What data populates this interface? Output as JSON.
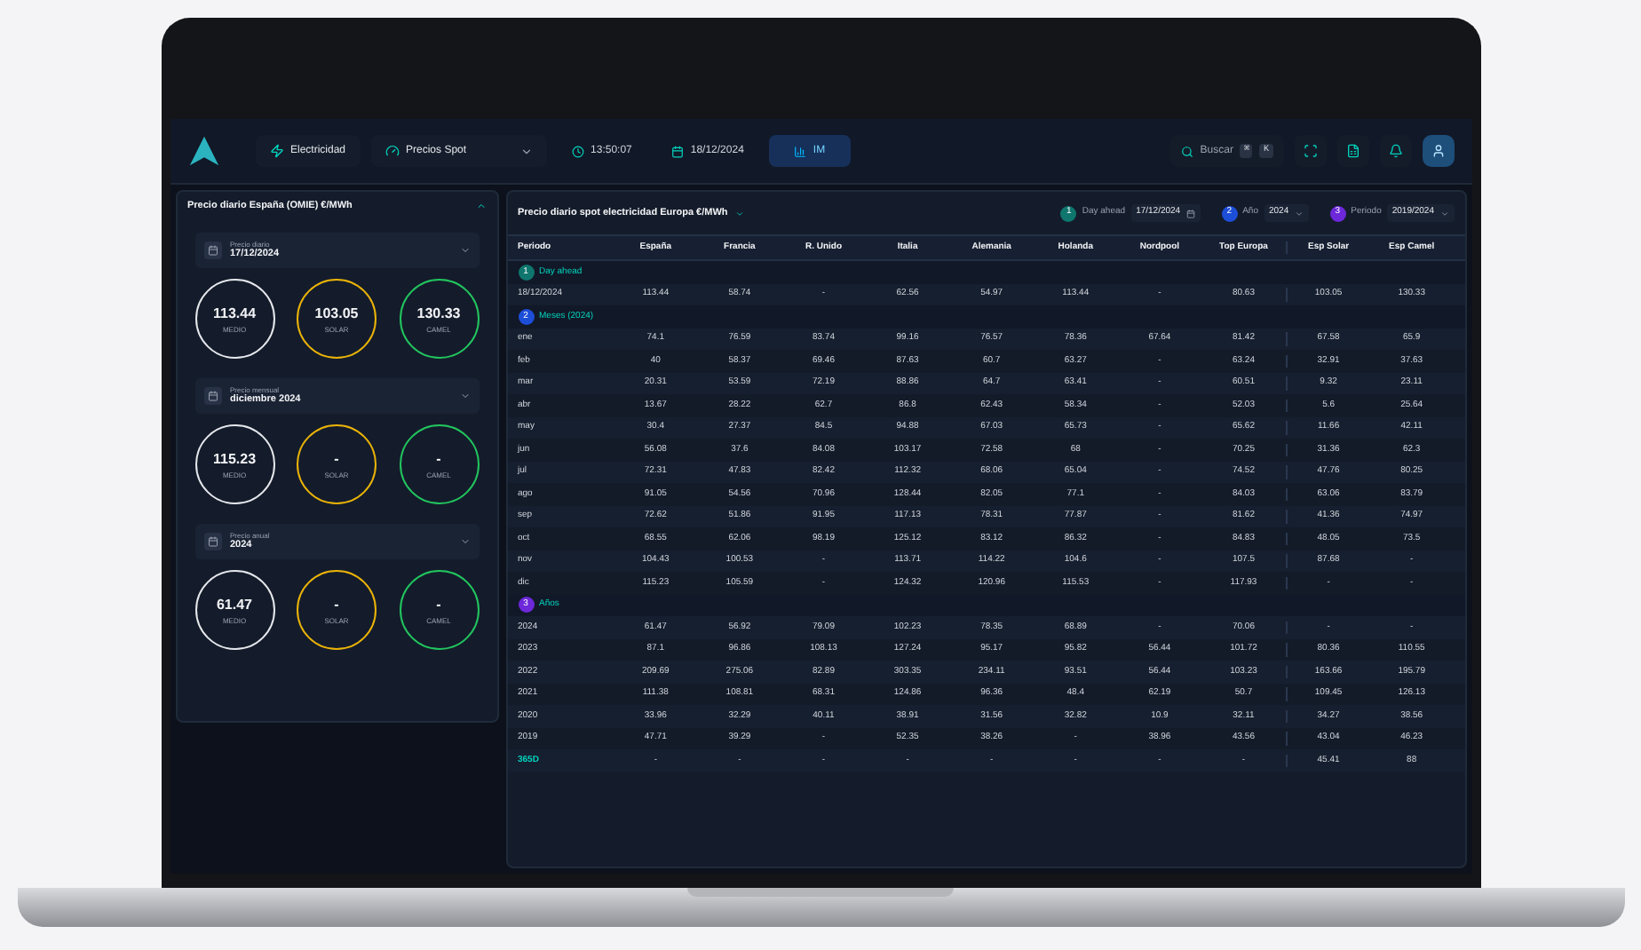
{
  "topbar": {
    "nav": [
      {
        "kind": "module",
        "label": "Electricidad"
      },
      {
        "kind": "dropdown",
        "label": "Precios Spot"
      },
      {
        "kind": "time",
        "label": "13:50:07"
      },
      {
        "kind": "date",
        "label": "18/12/2024"
      },
      {
        "kind": "button",
        "label": "IM"
      }
    ],
    "search": {
      "placeholder": "Buscar",
      "keys": [
        "⌘",
        "K"
      ]
    }
  },
  "left_panel": {
    "title": "Precio diario España (OMIE) €/MWh",
    "expanded": true,
    "sections": [
      {
        "label": "Precio diario",
        "value": "17/12/2024",
        "circles": [
          {
            "value": "113.44",
            "label": "MEDIO",
            "color": "#e5e7eb"
          },
          {
            "value": "103.05",
            "label": "SOLAR",
            "color": "#eab308"
          },
          {
            "value": "130.33",
            "label": "CAMEL",
            "color": "#22c55e"
          }
        ]
      },
      {
        "label": "Precio mensual",
        "value": "diciembre 2024",
        "circles": [
          {
            "value": "115.23",
            "label": "MEDIO",
            "color": "#e5e7eb"
          },
          {
            "value": "-",
            "label": "SOLAR",
            "color": "#eab308"
          },
          {
            "value": "-",
            "label": "CAMEL",
            "color": "#22c55e"
          }
        ]
      },
      {
        "label": "Precio anual",
        "value": "2024",
        "circles": [
          {
            "value": "61.47",
            "label": "MEDIO",
            "color": "#e5e7eb"
          },
          {
            "value": "-",
            "label": "SOLAR",
            "color": "#eab308"
          },
          {
            "value": "-",
            "label": "CAMEL",
            "color": "#22c55e"
          }
        ]
      }
    ]
  },
  "table_panel": {
    "title": "Precio diario spot electricidad Europa €/MWh",
    "filters": [
      {
        "badge": "1",
        "color": "#0f766e",
        "label": "Day ahead",
        "value": "17/12/2024",
        "kind": "date"
      },
      {
        "badge": "2",
        "color": "#1d4ed8",
        "label": "Año",
        "value": "2024",
        "kind": "select"
      },
      {
        "badge": "3",
        "color": "#6d28d9",
        "label": "Periodo",
        "value": "2019/2024",
        "kind": "select"
      }
    ],
    "columns": [
      "Periodo",
      "España",
      "Francia",
      "R. Unido",
      "Italia",
      "Alemania",
      "Holanda",
      "Nordpool",
      "Top Europa",
      "Esp Solar",
      "Esp Camel"
    ],
    "groups": [
      {
        "badge": "1",
        "color": "#0f766e",
        "label": "Day ahead",
        "rows": [
          {
            "highlight": false,
            "cells": [
              "18/12/2024",
              "113.44",
              "58.74",
              "-",
              "62.56",
              "54.97",
              "113.44",
              "-",
              "80.63",
              "103.05",
              "130.33"
            ]
          }
        ]
      },
      {
        "badge": "2",
        "color": "#1d4ed8",
        "label": "Meses (2024)",
        "rows": [
          {
            "highlight": false,
            "cells": [
              "ene",
              "74.1",
              "76.59",
              "83.74",
              "99.16",
              "76.57",
              "78.36",
              "67.64",
              "81.42",
              "67.58",
              "65.9"
            ]
          },
          {
            "highlight": false,
            "cells": [
              "feb",
              "40",
              "58.37",
              "69.46",
              "87.63",
              "60.7",
              "63.27",
              "-",
              "63.24",
              "32.91",
              "37.63"
            ]
          },
          {
            "highlight": false,
            "cells": [
              "mar",
              "20.31",
              "53.59",
              "72.19",
              "88.86",
              "64.7",
              "63.41",
              "-",
              "60.51",
              "9.32",
              "23.11"
            ]
          },
          {
            "highlight": false,
            "cells": [
              "abr",
              "13.67",
              "28.22",
              "62.7",
              "86.8",
              "62.43",
              "58.34",
              "-",
              "52.03",
              "5.6",
              "25.64"
            ]
          },
          {
            "highlight": false,
            "cells": [
              "may",
              "30.4",
              "27.37",
              "84.5",
              "94.88",
              "67.03",
              "65.73",
              "-",
              "65.62",
              "11.66",
              "42.11"
            ]
          },
          {
            "highlight": false,
            "cells": [
              "jun",
              "56.08",
              "37.6",
              "84.08",
              "103.17",
              "72.58",
              "68",
              "-",
              "70.25",
              "31.36",
              "62.3"
            ]
          },
          {
            "highlight": false,
            "cells": [
              "jul",
              "72.31",
              "47.83",
              "82.42",
              "112.32",
              "68.06",
              "65.04",
              "-",
              "74.52",
              "47.76",
              "80.25"
            ]
          },
          {
            "highlight": false,
            "cells": [
              "ago",
              "91.05",
              "54.56",
              "70.96",
              "128.44",
              "82.05",
              "77.1",
              "-",
              "84.03",
              "63.06",
              "83.79"
            ]
          },
          {
            "highlight": false,
            "cells": [
              "sep",
              "72.62",
              "51.86",
              "91.95",
              "117.13",
              "78.31",
              "77.87",
              "-",
              "81.62",
              "41.36",
              "74.97"
            ]
          },
          {
            "highlight": false,
            "cells": [
              "oct",
              "68.55",
              "62.06",
              "98.19",
              "125.12",
              "83.12",
              "86.32",
              "-",
              "84.83",
              "48.05",
              "73.5"
            ]
          },
          {
            "highlight": false,
            "cells": [
              "nov",
              "104.43",
              "100.53",
              "-",
              "113.71",
              "114.22",
              "104.6",
              "-",
              "107.5",
              "87.68",
              "-"
            ]
          },
          {
            "highlight": false,
            "cells": [
              "dic",
              "115.23",
              "105.59",
              "-",
              "124.32",
              "120.96",
              "115.53",
              "-",
              "117.93",
              "-",
              "-"
            ]
          }
        ]
      },
      {
        "badge": "3",
        "color": "#6d28d9",
        "label": "Años",
        "rows": [
          {
            "highlight": false,
            "cells": [
              "2024",
              "61.47",
              "56.92",
              "79.09",
              "102.23",
              "78.35",
              "68.89",
              "-",
              "70.06",
              "-",
              "-"
            ]
          },
          {
            "highlight": false,
            "cells": [
              "2023",
              "87.1",
              "96.86",
              "108.13",
              "127.24",
              "95.17",
              "95.82",
              "56.44",
              "101.72",
              "80.36",
              "110.55"
            ]
          },
          {
            "highlight": false,
            "cells": [
              "2022",
              "209.69",
              "275.06",
              "82.89",
              "303.35",
              "234.11",
              "93.51",
              "56.44",
              "103.23",
              "163.66",
              "195.79"
            ]
          },
          {
            "highlight": false,
            "cells": [
              "2021",
              "111.38",
              "108.81",
              "68.31",
              "124.86",
              "96.36",
              "48.4",
              "62.19",
              "50.7",
              "109.45",
              "126.13"
            ]
          },
          {
            "highlight": false,
            "cells": [
              "2020",
              "33.96",
              "32.29",
              "40.11",
              "38.91",
              "31.56",
              "32.82",
              "10.9",
              "32.11",
              "34.27",
              "38.56"
            ]
          },
          {
            "highlight": false,
            "cells": [
              "2019",
              "47.71",
              "39.29",
              "-",
              "52.35",
              "38.26",
              "-",
              "38.96",
              "43.56",
              "43.04",
              "46.23"
            ]
          },
          {
            "highlight": true,
            "cells": [
              "365D",
              "-",
              "-",
              "-",
              "-",
              "-",
              "-",
              "-",
              "-",
              "45.41",
              "88"
            ]
          }
        ]
      }
    ]
  }
}
